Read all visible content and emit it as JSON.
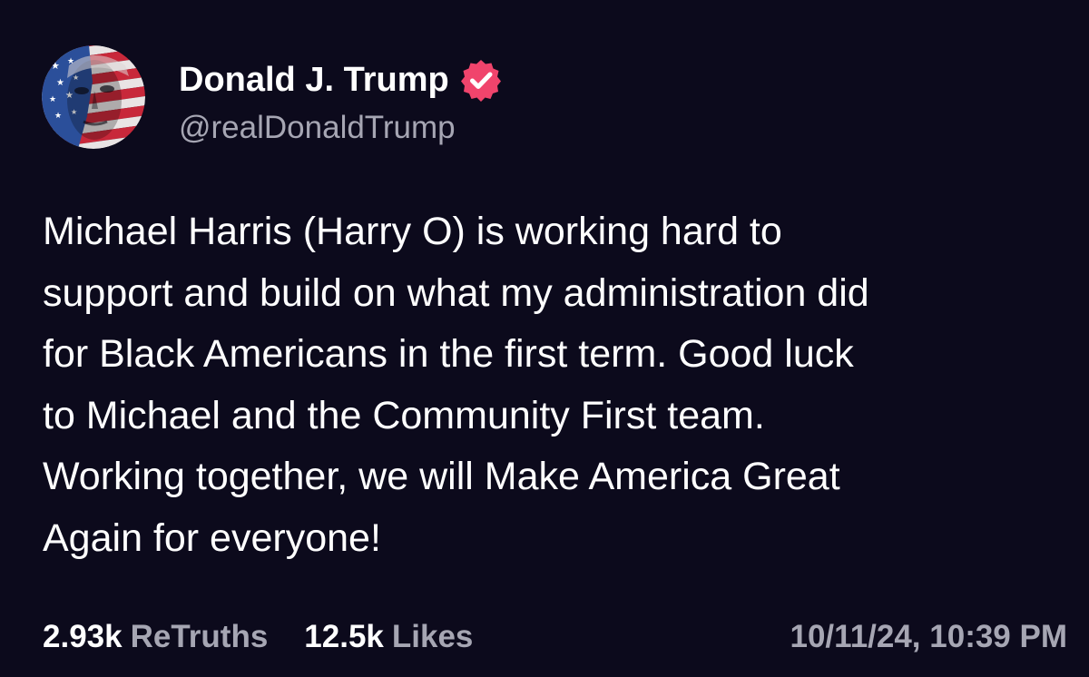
{
  "author": {
    "display_name": "Donald J. Trump",
    "handle": "@realDonaldTrump",
    "verified_icon": "verified-badge-icon",
    "verified_color": "#f0446c",
    "avatar_icon": "flag-portrait-avatar"
  },
  "post": {
    "text": "Michael Harris (Harry O) is working hard to\nsupport and build on what my administration did\nfor Black Americans in the first term. Good luck\nto Michael and the Community First team.\nWorking together, we will Make America Great\nAgain for everyone!"
  },
  "stats": {
    "retruths_count": "2.93k",
    "retruths_label": "ReTruths",
    "likes_count": "12.5k",
    "likes_label": "Likes"
  },
  "timestamp": "10/11/24, 10:39 PM",
  "colors": {
    "background": "#0c0a1c",
    "text_primary": "#ffffff",
    "text_secondary": "#a6a6b3"
  }
}
